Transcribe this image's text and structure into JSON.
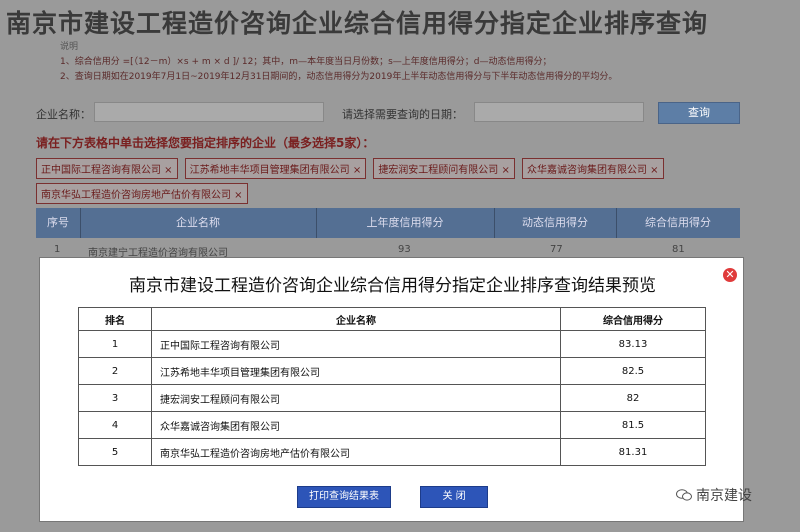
{
  "background": {
    "title": "南京市建设工程造价咨询企业综合信用得分指定企业排序查询",
    "notes_label": "说明",
    "notes": [
      "1、综合信用分 =[（12－m）×s + m × d ]/ 12；其中，m—本年度当日月份数；s—上年度信用得分；d—动态信用得分；",
      "2、查询日期如在2019年7月1日~2019年12月31日期间的，动态信用得分为2019年上半年动态信用得分与下半年动态信用得分的平均分。"
    ],
    "form": {
      "company_label": "企业名称：",
      "company_value": "",
      "date_label": "请选择需要查询的日期：",
      "date_value": "",
      "query_button": "查询"
    },
    "hint": "请在下方表格中单击选择您要指定排序的企业（最多选择5家）：",
    "tags": [
      "正中国际工程咨询有限公司 ×",
      "江苏希地丰华项目管理集团有限公司 ×",
      "捷宏润安工程顾问有限公司 ×",
      "众华嘉诚咨询集团有限公司 ×",
      "南京华弘工程造价咨询房地产估价有限公司 ×"
    ],
    "table_headers": [
      "序号",
      "企业名称",
      "上年度信用得分",
      "动态信用得分",
      "综合信用得分"
    ],
    "partial_row": [
      "1",
      "南京建宁工程造价咨询有限公司",
      "93",
      "77",
      "81"
    ]
  },
  "modal": {
    "title": "南京市建设工程造价咨询企业综合信用得分指定企业排序查询结果预览",
    "close_icon": "close-icon",
    "headers": [
      "排名",
      "企业名称",
      "综合信用得分"
    ],
    "rows": [
      {
        "rank": "1",
        "name": "正中国际工程咨询有限公司",
        "score": "83.13"
      },
      {
        "rank": "2",
        "name": "江苏希地丰华项目管理集团有限公司",
        "score": "82.5"
      },
      {
        "rank": "3",
        "name": "捷宏润安工程顾问有限公司",
        "score": "82"
      },
      {
        "rank": "4",
        "name": "众华嘉诚咨询集团有限公司",
        "score": "81.5"
      },
      {
        "rank": "5",
        "name": "南京华弘工程造价咨询房地产估价有限公司",
        "score": "81.31"
      }
    ],
    "print_button": "打印查询结果表",
    "close_button": "关 闭"
  },
  "watermark": {
    "icon": "wechat-icon",
    "text": "南京建设"
  },
  "colors": {
    "header_blue": "#546f93",
    "button_blue": "#2d55b8",
    "close_red": "#e03b3b"
  }
}
